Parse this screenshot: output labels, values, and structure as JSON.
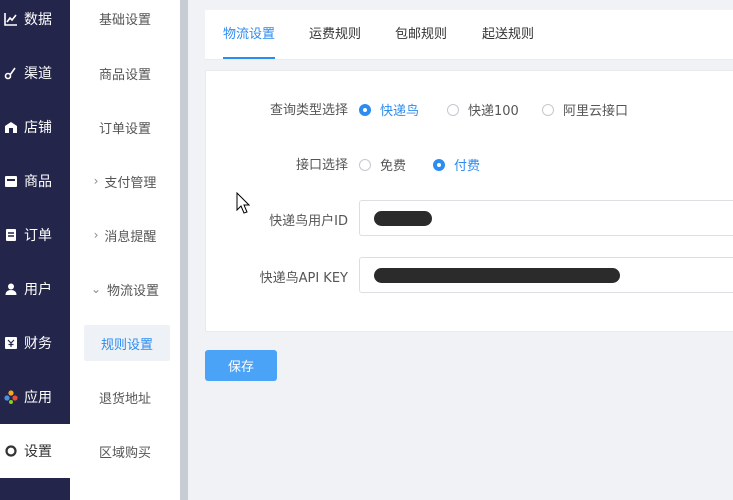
{
  "primary_nav": [
    {
      "label": "数据",
      "icon": "chart-icon"
    },
    {
      "label": "渠道",
      "icon": "channel-icon"
    },
    {
      "label": "店铺",
      "icon": "store-icon"
    },
    {
      "label": "商品",
      "icon": "goods-icon"
    },
    {
      "label": "订单",
      "icon": "order-icon"
    },
    {
      "label": "用户",
      "icon": "user-icon"
    },
    {
      "label": "财务",
      "icon": "finance-icon"
    },
    {
      "label": "应用",
      "icon": "apps-icon"
    },
    {
      "label": "设置",
      "icon": "settings-icon",
      "active": true
    }
  ],
  "secondary_nav": [
    {
      "label": "基础设置"
    },
    {
      "label": "商品设置"
    },
    {
      "label": "订单设置"
    },
    {
      "label": "支付管理",
      "chevron": "›"
    },
    {
      "label": "消息提醒",
      "chevron": "›"
    },
    {
      "label": "物流设置",
      "chevron": "⌄"
    },
    {
      "label": "规则设置",
      "active": true
    },
    {
      "label": "退货地址"
    },
    {
      "label": "区域购买"
    }
  ],
  "tabs": [
    {
      "label": "物流设置",
      "active": true
    },
    {
      "label": "运费规则"
    },
    {
      "label": "包邮规则"
    },
    {
      "label": "起送规则"
    }
  ],
  "form": {
    "query_type": {
      "label": "查询类型选择",
      "options": [
        "快递鸟",
        "快递100",
        "阿里云接口"
      ],
      "selected": "快递鸟"
    },
    "api_select": {
      "label": "接口选择",
      "options": [
        "免费",
        "付费"
      ],
      "selected": "付费"
    },
    "user_id": {
      "label": "快递鸟用户ID",
      "value": ""
    },
    "api_key": {
      "label": "快递鸟API KEY",
      "value": ""
    }
  },
  "save_label": "保存",
  "colors": {
    "accent": "#2d8cf0",
    "sidebar_bg": "#23254a",
    "save_button": "#4aa3f7"
  }
}
